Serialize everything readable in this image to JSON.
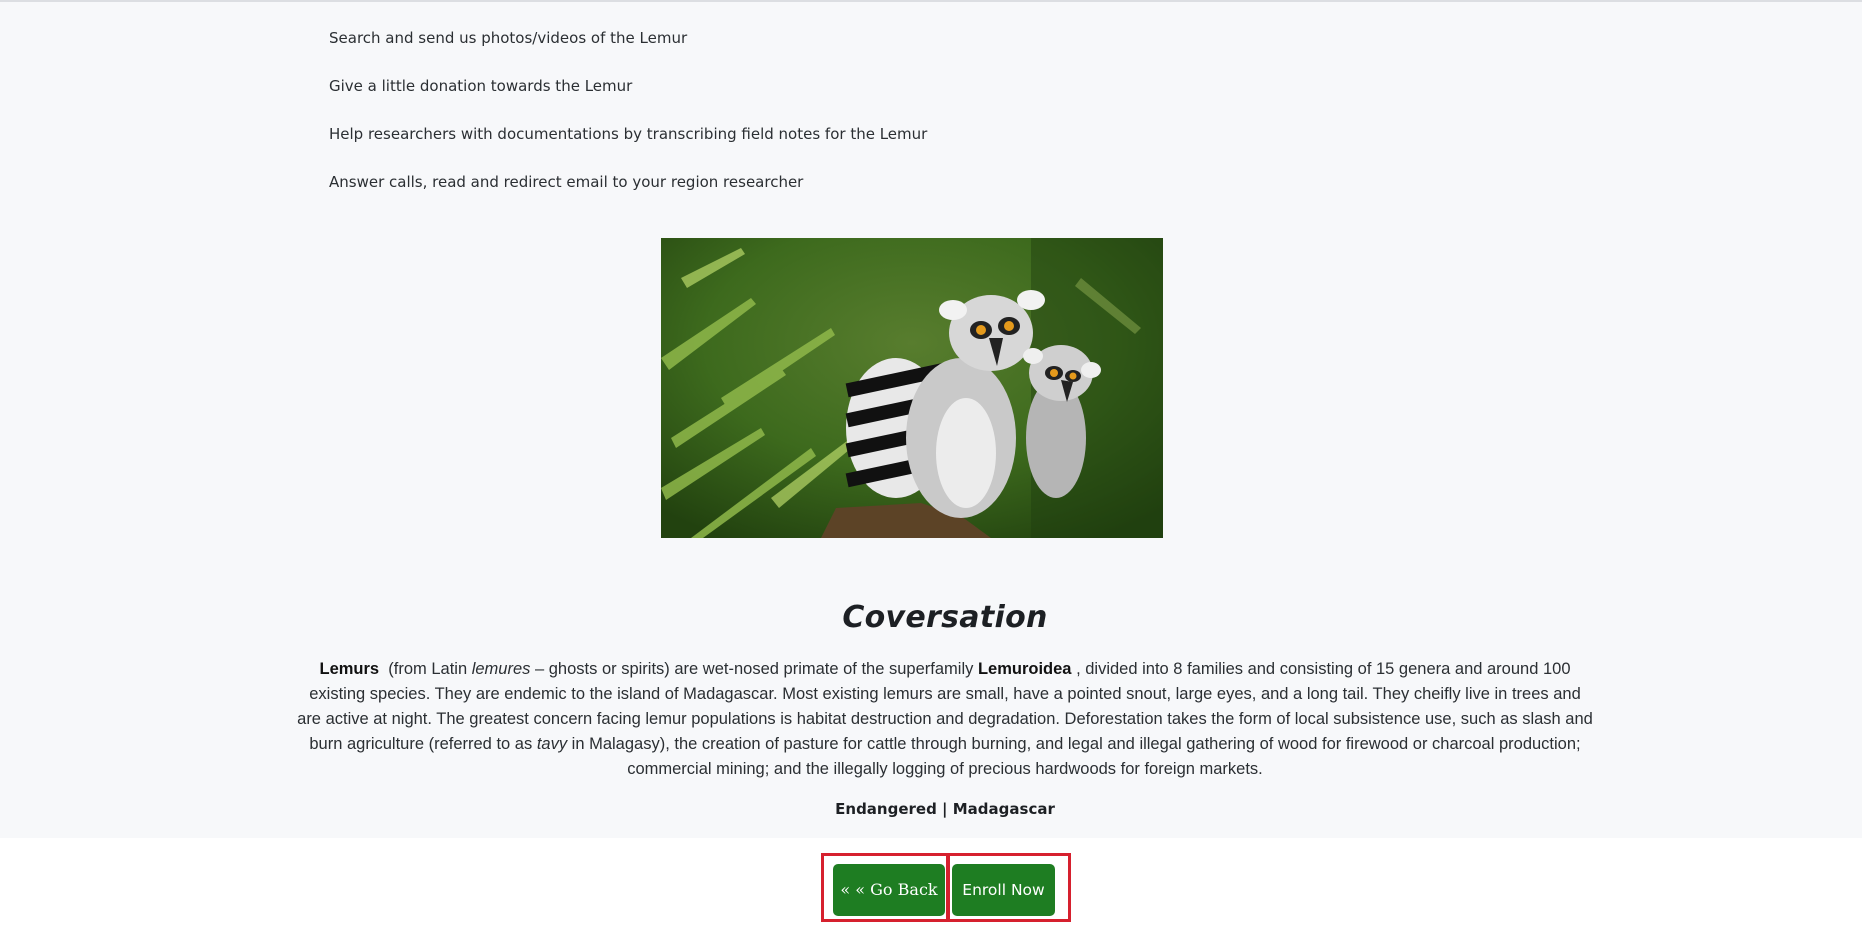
{
  "tasks": [
    "Search and send us photos/videos of the Lemur",
    "Give a little donation towards the Lemur",
    "Help researchers with documentations by transcribing field notes for the Lemur",
    "Answer calls, read and redirect email to your region researcher"
  ],
  "section": {
    "title": "Coversation",
    "description": {
      "name": "Lemurs",
      "part1": "(from Latin",
      "latin": "lemures",
      "part2": "– ghosts or spirits) are wet-nosed primate of the superfamily",
      "superfamily": "Lemuroidea",
      "part3": ", divided into 8 families and consisting of 15 genera and around 100 existing species. They are endemic to the island of Madagascar. Most existing lemurs are small, have a pointed snout, large eyes, and a long tail. They cheifly live in trees and are active at night. The greatest concern facing lemur populations is habitat destruction and degradation. Deforestation takes the form of local subsistence use, such as slash and burn agriculture (referred to as",
      "local": "tavy",
      "part4": "in Malagasy), the creation of pasture for cattle through burning, and legal and illegal gathering of wood for firewood or charcoal production; commercial mining; and the illegally logging of precious hardwoods for foreign markets."
    },
    "status": "Endangered | Madagascar"
  },
  "buttons": {
    "back_label": "« « Go Back",
    "enroll_label": "Enroll Now",
    "color": "#1e7d22",
    "highlight": "#d6202e"
  }
}
